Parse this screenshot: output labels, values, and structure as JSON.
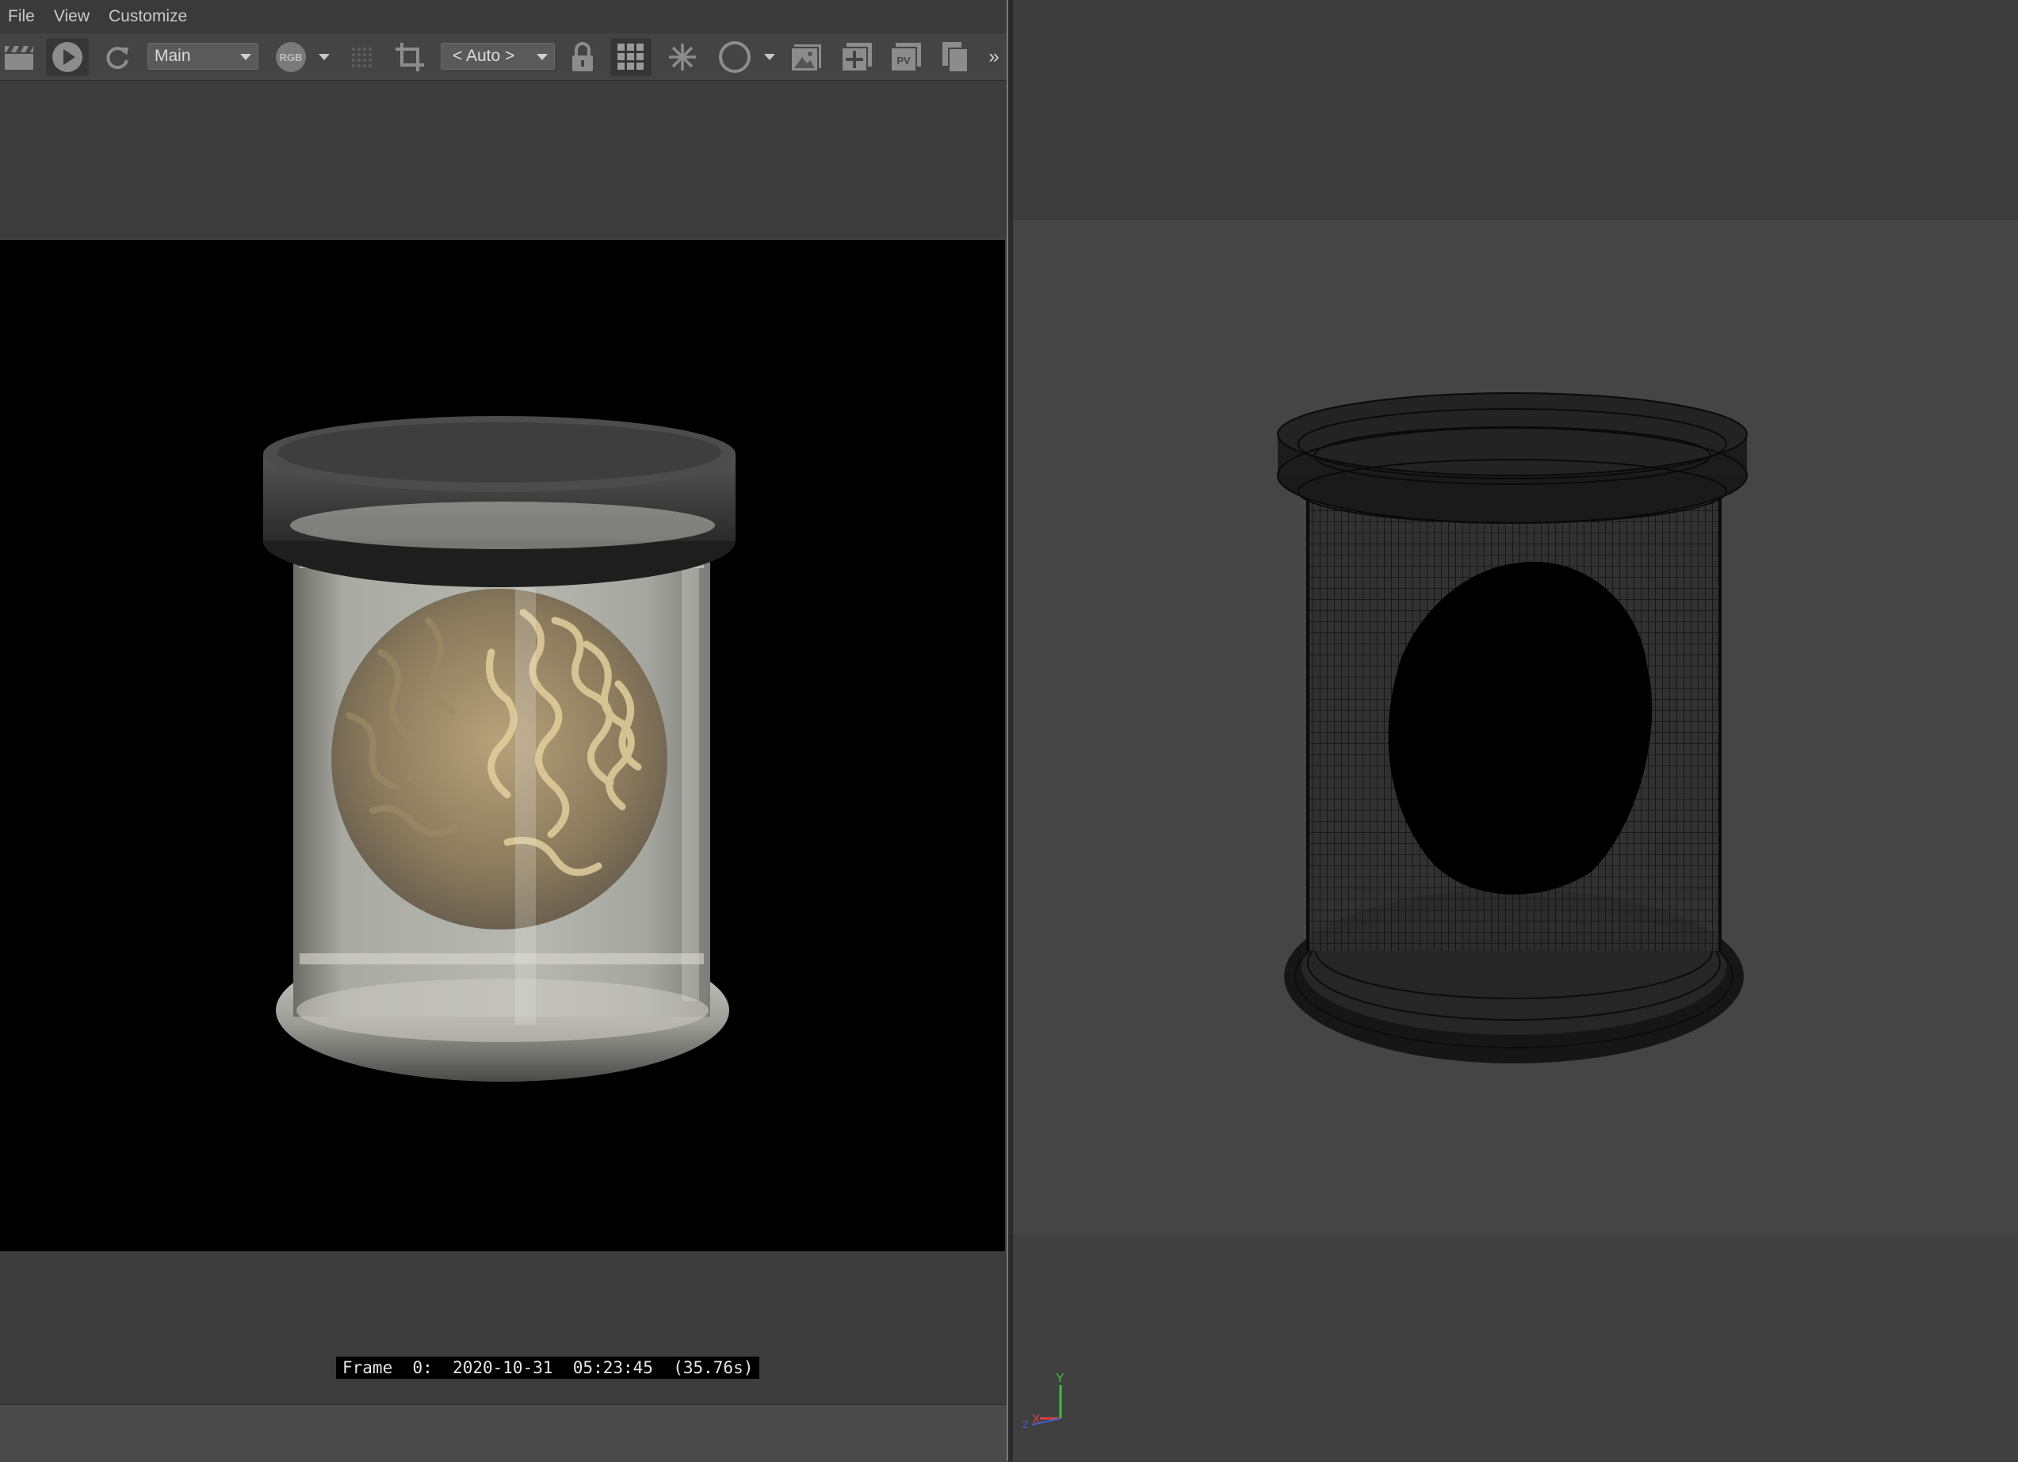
{
  "menu": {
    "items": [
      "File",
      "View",
      "Customize"
    ]
  },
  "toolbar": {
    "channel_dropdown": "Main",
    "rgb_label": "RGB",
    "zoom_dropdown": "< Auto >",
    "pv_label": "PV",
    "more_glyph": "»"
  },
  "status": {
    "stamp": "Frame  0:  2020-10-31  05:23:45  (35.76s)"
  },
  "viewport": {
    "axis_y": "Y",
    "axis_x": "X",
    "axis_z": "Z"
  },
  "colors": {
    "axis_y": "#3fbf3f",
    "axis_x": "#d94040",
    "axis_z": "#4060d0"
  }
}
